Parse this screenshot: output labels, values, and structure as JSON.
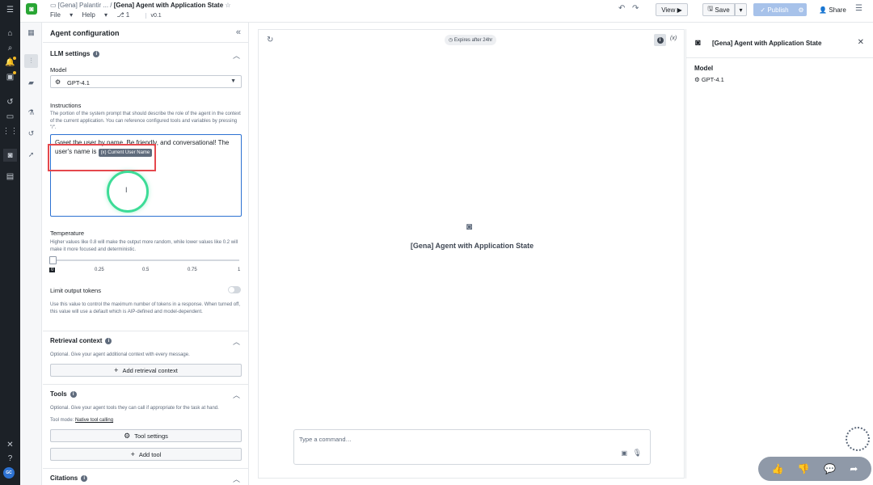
{
  "header": {
    "breadcrumb_folder": "[Gena] Palantir ...",
    "doc_title": "[Gena] Agent with Application State",
    "menu_file": "File",
    "menu_help": "Help",
    "branch_count": "1",
    "version": "v0.1",
    "view_label": "View",
    "save_label": "Save",
    "publish_label": "Publish",
    "share_label": "Share"
  },
  "config": {
    "title": "Agent configuration",
    "llm_settings": "LLM settings",
    "model_label": "Model",
    "model_value": "GPT-4.1",
    "instructions_label": "Instructions",
    "instructions_help": "The portion of the system prompt that should describe the role of the agent in the context of the current application. You can reference configured tools and variables by pressing \"/\".",
    "instructions_text": "Greet the user by name. Be friendly, and conversational! The user's name is",
    "variable_chip": "Current User Name",
    "variable_chip_prefix": "(x)",
    "temperature_label": "Temperature",
    "temperature_help": "Higher values like 0.8 will make the output more random, while lower values like 0.2 will make it more focused and deterministic.",
    "temperature_value": 0,
    "temperature_ticks": [
      "0",
      "0.25",
      "0.5",
      "0.75",
      "1"
    ],
    "limit_tokens_label": "Limit output tokens",
    "limit_tokens_help": "Use this value to control the maximum number of tokens in a response. When turned off, this value will use a default which is AIP-defined and model-dependent.",
    "retrieval_title": "Retrieval context",
    "retrieval_help": "Optional. Give your agent additional context with every message.",
    "add_retrieval_label": "Add retrieval context",
    "tools_title": "Tools",
    "tools_help": "Optional. Give your agent tools they can call if appropriate for the task at hand.",
    "tool_mode_prefix": "Tool mode:",
    "tool_mode_value": "Native tool calling",
    "tool_settings_label": "Tool settings",
    "add_tool_label": "Add tool",
    "citations_title": "Citations"
  },
  "canvas": {
    "expires_label": "Expires after 24hr",
    "vars_label": "(x)",
    "agent_name": "[Gena] Agent with Application State",
    "command_placeholder": "Type a command…"
  },
  "right_panel": {
    "title": "[Gena] Agent with Application State",
    "model_label": "Model",
    "model_value": "GPT-4.1"
  },
  "user": {
    "initials": "GC"
  }
}
